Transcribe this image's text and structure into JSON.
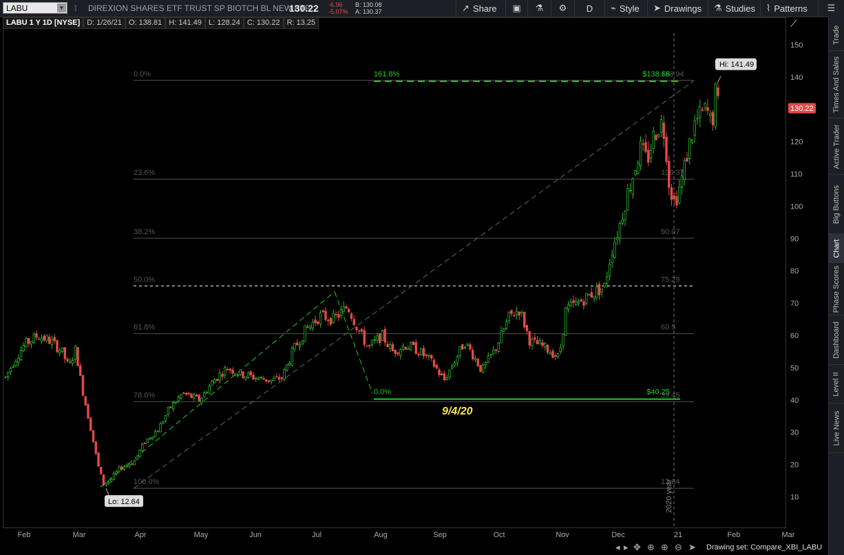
{
  "toolbar": {
    "symbol": "LABU",
    "description": "DIREXION SHARES ETF TRUST SP BIOTCH BL NEW ETF",
    "last": "130.22",
    "net_change": "-6.96",
    "pct_change": "-5.07%",
    "bid": "B: 130.08",
    "ask": "A: 130.37",
    "buttons": {
      "share": "Share",
      "period": "D",
      "style": "Style",
      "drawings": "Drawings",
      "studies": "Studies",
      "patterns": "Patterns"
    }
  },
  "info_bar": {
    "title": "LABU 1 Y 1D [NYSE]",
    "date": "D: 1/26/21",
    "open": "O: 138.81",
    "high": "H: 141.49",
    "low": "L: 128.24",
    "close": "C: 130.22",
    "range": "R: 13.25"
  },
  "right_tabs": [
    "Trade",
    "Times And Sales",
    "Active Trader",
    "Big Buttons",
    "Chart",
    "Phase Scores",
    "Dashboard",
    "Level II",
    "Live News"
  ],
  "active_tab": "Chart",
  "bottom": {
    "drawing_set": "Drawing set: Compare_XBI_LABU"
  },
  "chart_data": {
    "type": "candlestick",
    "symbol": "LABU",
    "period": "1 Y 1D",
    "ylim": [
      0,
      155
    ],
    "y_ticks": [
      10,
      20,
      30,
      40,
      50,
      60,
      70,
      80,
      90,
      100,
      110,
      120,
      130,
      140,
      150
    ],
    "x_ticks": [
      "Feb",
      "Mar",
      "Apr",
      "May",
      "Jun",
      "Jul",
      "Aug",
      "Sep",
      "Oct",
      "Nov",
      "Dec",
      "21",
      "Feb",
      "Mar"
    ],
    "last_price_label": "130.22",
    "high_label": "Hi: 141.49",
    "low_label": "Lo: 12.64",
    "fib_retracement": [
      {
        "pct": "0.0%",
        "value": 138.94,
        "value_label": "138.94"
      },
      {
        "pct": "23.6%",
        "value": 108.37,
        "value_label": "108.37"
      },
      {
        "pct": "38.2%",
        "value": 90.07,
        "value_label": "90.07"
      },
      {
        "pct": "50.0%",
        "value": 75.29,
        "value_label": "75.29"
      },
      {
        "pct": "61.8%",
        "value": 60.5,
        "value_label": "60.5"
      },
      {
        "pct": "78.6%",
        "value": 39.45,
        "value_label": "39.45"
      },
      {
        "pct": "100.0%",
        "value": 12.64,
        "value_label": "12.64"
      }
    ],
    "fib_extension": [
      {
        "pct": "161.8%",
        "value": 138.66,
        "value_label": "$138.66"
      },
      {
        "pct": "0.0%",
        "value": 40.25,
        "value_label": "$40.25"
      }
    ],
    "annotation": "9/4/20",
    "vertical_marker_label": "2020 year",
    "colors": {
      "up": "#2db52d",
      "down": "#e34a4a",
      "fib": "#777777",
      "ext": "#22cc22",
      "annotation": "#f5e642"
    }
  }
}
